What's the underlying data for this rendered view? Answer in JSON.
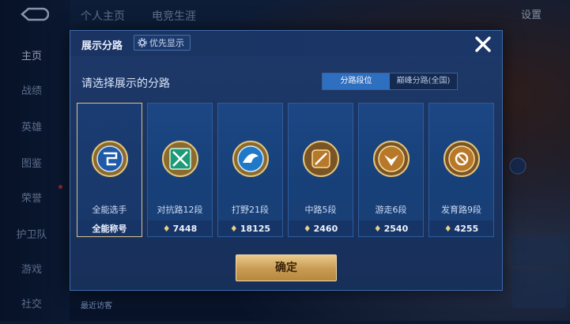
{
  "sidebar": {
    "items": [
      {
        "label": "主页",
        "active": true
      },
      {
        "label": "战绩",
        "active": false
      },
      {
        "label": "英雄",
        "active": false
      },
      {
        "label": "图鉴",
        "active": false
      },
      {
        "label": "荣誉",
        "active": false
      },
      {
        "label": "护卫队",
        "active": false
      },
      {
        "label": "游戏",
        "active": false
      },
      {
        "label": "社交",
        "active": false
      }
    ]
  },
  "top_nav": {
    "tabs": [
      "个人主页",
      "电竞生涯"
    ],
    "settings_label": "设置"
  },
  "modal": {
    "title": "展示分路",
    "priority_label": "优先显示",
    "subtitle": "请选择展示的分路",
    "tabs": [
      {
        "label": "分路段位",
        "active": true
      },
      {
        "label": "巅峰分路(全国)",
        "active": false
      }
    ],
    "cards": [
      {
        "label": "全能选手",
        "value": "全能称号",
        "selected": true,
        "icon": "all-round-emblem-icon",
        "color": "#3a7bd5"
      },
      {
        "label": "对抗路12段",
        "value": "7448",
        "selected": false,
        "icon": "clash-lane-emblem-icon",
        "color": "#2bb38a"
      },
      {
        "label": "打野21段",
        "value": "18125",
        "selected": false,
        "icon": "jungle-emblem-icon",
        "color": "#2b8ad8"
      },
      {
        "label": "中路5段",
        "value": "2460",
        "selected": false,
        "icon": "mid-lane-emblem-icon",
        "color": "#c98a2a"
      },
      {
        "label": "游走6段",
        "value": "2540",
        "selected": false,
        "icon": "roam-emblem-icon",
        "color": "#c98a2a"
      },
      {
        "label": "发育路9段",
        "value": "4255",
        "selected": false,
        "icon": "farm-lane-emblem-icon",
        "color": "#c98a2a"
      }
    ],
    "confirm_label": "确定"
  },
  "bottom": {
    "recent_label": "最近访客"
  }
}
